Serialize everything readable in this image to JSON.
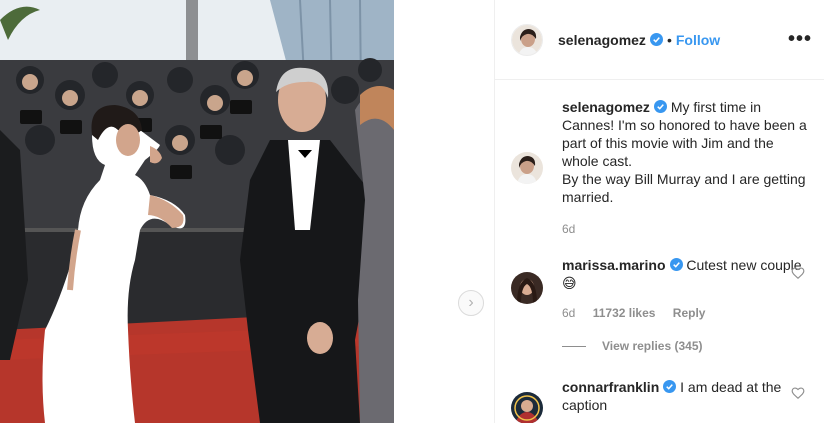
{
  "post": {
    "author": "selenagomez",
    "follow_label": "Follow",
    "separator": "•",
    "more_label": "•••",
    "caption": "My first time in Cannes! I'm so honored to have been a part of this movie with Jim and the whole cast.\nBy the way Bill Murray and I are getting married.",
    "caption_age": "6d"
  },
  "comments": [
    {
      "user": "marissa.marino",
      "text": "Cutest new couple 😅",
      "age": "6d",
      "likes": "11732 likes",
      "reply_label": "Reply",
      "view_replies": "View replies (345)"
    },
    {
      "user": "connarfranklin",
      "text": "I am dead at the caption"
    }
  ],
  "nav": {
    "next_icon": "chevron-right-icon"
  },
  "colors": {
    "link": "#3897f0",
    "verified": "#3897f0",
    "muted": "#8e8e8e",
    "carpet": "#c0392b"
  }
}
